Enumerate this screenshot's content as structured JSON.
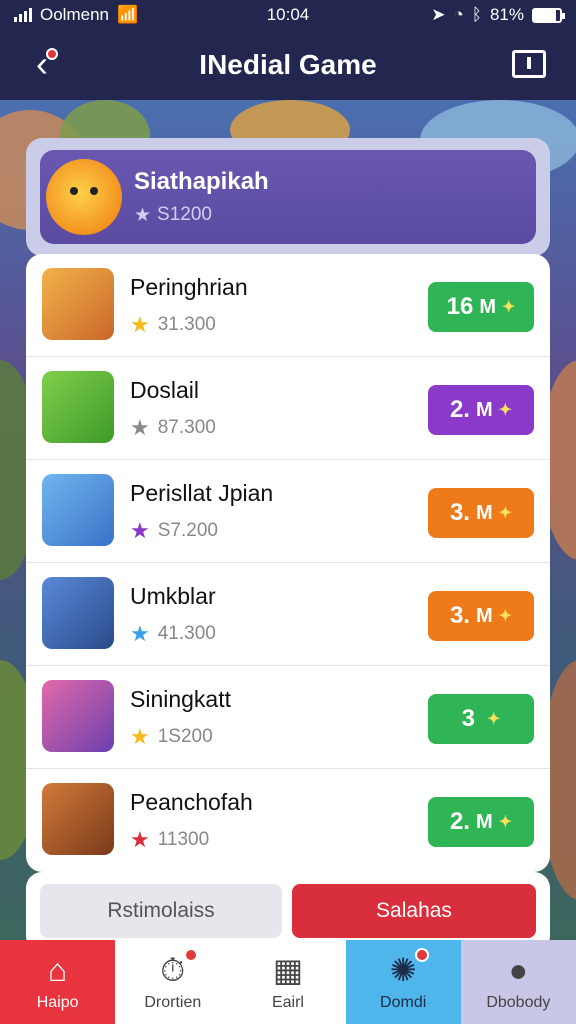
{
  "status": {
    "carrier": "Oolmenn",
    "time": "10:04",
    "battery": "81%"
  },
  "header": {
    "title": "INedial Game"
  },
  "featured": {
    "name": "Siathapikah",
    "score": "S1200"
  },
  "leaderboard": [
    {
      "name": "Peringhrian",
      "score": "31.300",
      "badge": "16",
      "suffix": "M",
      "star_color": "#f6b81a",
      "badge_color": "#2fb556"
    },
    {
      "name": "Doslail",
      "score": "87.300",
      "badge": "2.",
      "suffix": "M",
      "star_color": "#8a8a8a",
      "badge_color": "#8a39c8"
    },
    {
      "name": "Perisllat Jpian",
      "score": "S7.200",
      "badge": "3.",
      "suffix": "M",
      "star_color": "#8a39c8",
      "badge_color": "#ef7a1a"
    },
    {
      "name": "Umkblar",
      "score": "41.300",
      "badge": "3.",
      "suffix": "M",
      "star_color": "#3aa0e8",
      "badge_color": "#ef7a1a"
    },
    {
      "name": "Siningkatt",
      "score": "1S200",
      "badge": "3",
      "suffix": "",
      "star_color": "#f6b81a",
      "badge_color": "#2fb556"
    },
    {
      "name": "Peanchofah",
      "score": "11300",
      "badge": "2.",
      "suffix": "M",
      "star_color": "#d92e3c",
      "badge_color": "#2fb556"
    }
  ],
  "actions": {
    "secondary": "Rstimolaiss",
    "primary": "Salahas"
  },
  "tabs": [
    {
      "label": "Haipo",
      "bg": "#e8343e",
      "fg": "#ffffff",
      "icon": "home-icon"
    },
    {
      "label": "Drortien",
      "bg": "#ffffff",
      "fg": "#444444",
      "icon": "stopwatch-icon"
    },
    {
      "label": "Eairl",
      "bg": "#ffffff",
      "fg": "#444444",
      "icon": "calendar-icon"
    },
    {
      "label": "Domdi",
      "bg": "#4fb6ec",
      "fg": "#1d2a4a",
      "icon": "compass-icon"
    },
    {
      "label": "Dbobody",
      "bg": "#c9c7e8",
      "fg": "#444444",
      "icon": "profile-icon"
    }
  ]
}
